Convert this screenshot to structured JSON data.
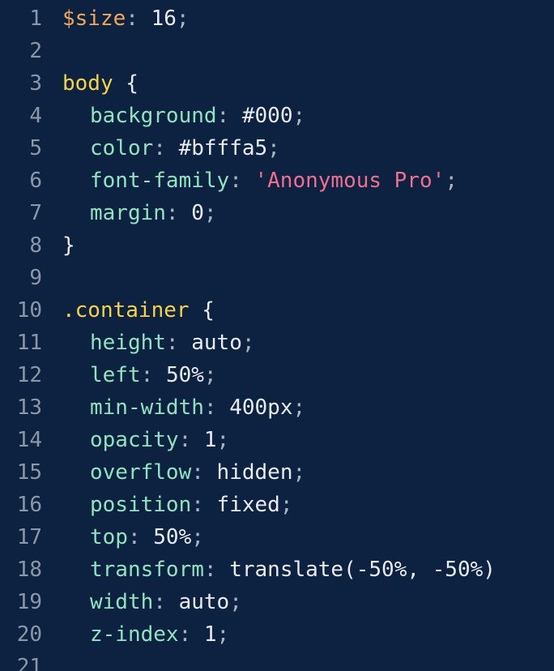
{
  "colors": {
    "background": "#0d2240",
    "line_number": "#8a97a8",
    "variable": "#f2a65a",
    "selector": "#f5d24a",
    "property": "#8fe3c0",
    "punctuation": "#a9b4c2",
    "value": "#e8ecf0",
    "string": "#ee6f8f"
  },
  "lines": [
    {
      "n": "1"
    },
    {
      "n": "2"
    },
    {
      "n": "3"
    },
    {
      "n": "4"
    },
    {
      "n": "5"
    },
    {
      "n": "6"
    },
    {
      "n": "7"
    },
    {
      "n": "8"
    },
    {
      "n": "9"
    },
    {
      "n": "10"
    },
    {
      "n": "11"
    },
    {
      "n": "12"
    },
    {
      "n": "13"
    },
    {
      "n": "14"
    },
    {
      "n": "15"
    },
    {
      "n": "16"
    },
    {
      "n": "17"
    },
    {
      "n": "18"
    },
    {
      "n": "19"
    },
    {
      "n": "20"
    },
    {
      "n": "21"
    }
  ],
  "code": {
    "size_var": "$size",
    "size_val": "16",
    "body_sel": "body",
    "body_props": [
      {
        "prop": "background",
        "val": "#000"
      },
      {
        "prop": "color",
        "val": "#bfffa5"
      },
      {
        "prop": "font-family",
        "val": "'Anonymous Pro'"
      },
      {
        "prop": "margin",
        "val": "0"
      }
    ],
    "container_sel": ".container",
    "container_props": [
      {
        "prop": "height",
        "val": "auto"
      },
      {
        "prop": "left",
        "val": "50%"
      },
      {
        "prop": "min-width",
        "val": "400px"
      },
      {
        "prop": "opacity",
        "val": "1"
      },
      {
        "prop": "overflow",
        "val": "hidden"
      },
      {
        "prop": "position",
        "val": "fixed"
      },
      {
        "prop": "top",
        "val": "50%"
      },
      {
        "prop": "transform",
        "val": "translate(-50%, -50%)"
      },
      {
        "prop": "width",
        "val": "auto"
      },
      {
        "prop": "z-index",
        "val": "1"
      }
    ]
  }
}
